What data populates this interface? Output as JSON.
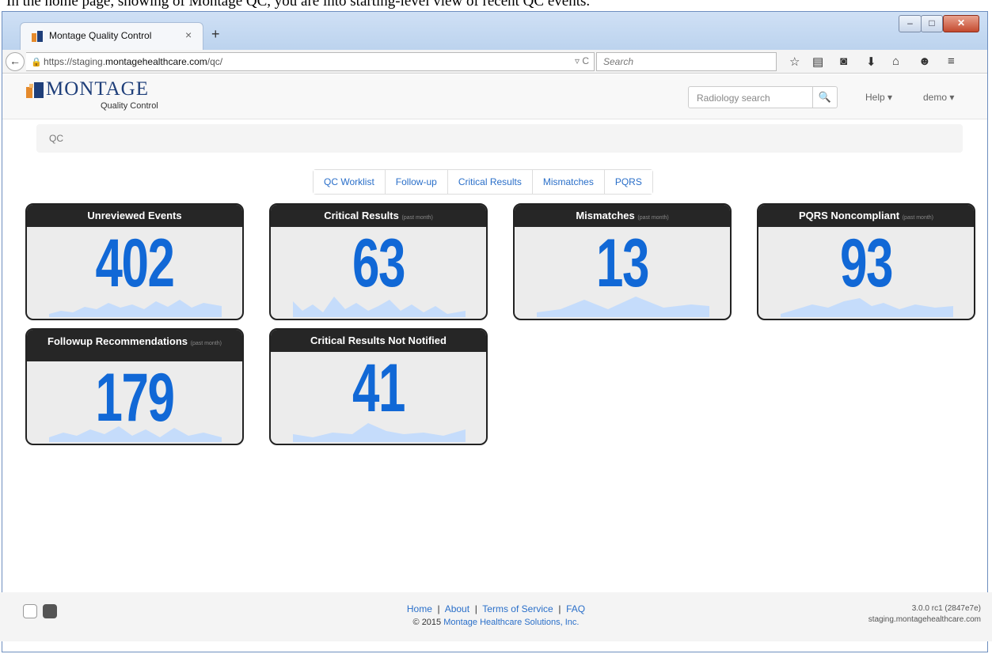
{
  "caption": "In the home page, showing of Montage QC, you are into starting-level view of recent QC events.",
  "browser": {
    "tab_title": "Montage Quality Control",
    "tab_close": "×",
    "new_tab": "+",
    "url_prefix": "https://staging.",
    "url_domain": "montagehealthcare.com",
    "url_path": "/qc/",
    "search_placeholder": "Search",
    "window_controls": {
      "minimize": "–",
      "maximize": "□",
      "close": "✕"
    }
  },
  "app": {
    "logo": "MONTAGE",
    "logo_sub": "Quality Control",
    "search_placeholder": "Radiology search",
    "help_menu": "Help ▾",
    "user_menu": "demo ▾"
  },
  "breadcrumb": "QC",
  "nav_pills": [
    "QC Worklist",
    "Follow-up",
    "Critical Results",
    "Mismatches",
    "PQRS"
  ],
  "tiles": [
    {
      "title": "Unreviewed Events",
      "sub": "",
      "value": "402"
    },
    {
      "title": "Critical Results",
      "sub": "(past month)",
      "value": "63"
    },
    {
      "title": "Mismatches",
      "sub": "(past month)",
      "value": "13"
    },
    {
      "title": "PQRS Noncompliant",
      "sub": "(past month)",
      "value": "93"
    },
    {
      "title": "Followup Recommendations",
      "sub": "(past month)",
      "value": "179"
    },
    {
      "title": "Critical Results Not Notified",
      "sub": "",
      "value": "41"
    }
  ],
  "footer": {
    "links": [
      "Home",
      "About",
      "Terms of Service",
      "FAQ"
    ],
    "copyright_prefix": "© 2015",
    "copyright_link": "Montage Healthcare Solutions, Inc.",
    "version": "3.0.0 rc1 (2847e7e)",
    "host": "staging.montagehealthcare.com"
  },
  "colors": {
    "accent": "#1168d6",
    "link": "#2a6fc9",
    "tile_head": "#262626",
    "spark": "#c5dcfb"
  }
}
